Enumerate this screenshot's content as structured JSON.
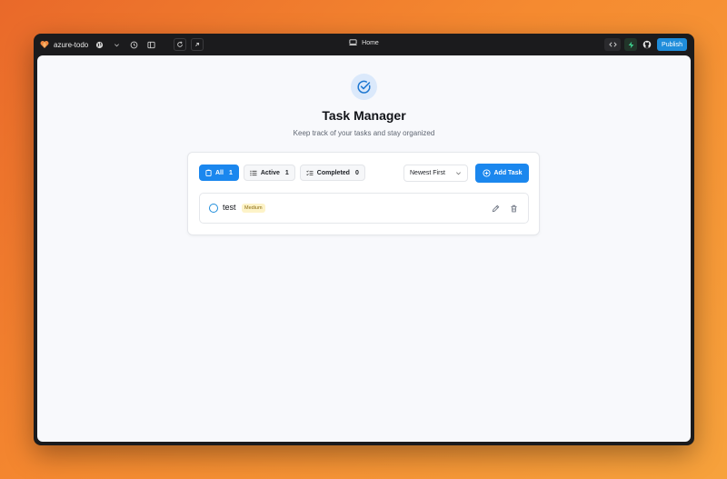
{
  "topbar": {
    "app_name": "azure-todo",
    "center_title": "Home",
    "publish_label": "Publish"
  },
  "header": {
    "title": "Task Manager",
    "subtitle": "Keep track of your tasks and stay organized"
  },
  "filters": [
    {
      "label": "All",
      "count": "1",
      "active": true
    },
    {
      "label": "Active",
      "count": "1",
      "active": false
    },
    {
      "label": "Completed",
      "count": "0",
      "active": false
    }
  ],
  "sort": {
    "selected": "Newest First"
  },
  "add_task_label": "Add Task",
  "tasks": [
    {
      "title": "test",
      "priority": "Medium",
      "completed": false
    }
  ],
  "colors": {
    "accent": "#1b87ee",
    "priority_medium_bg": "#fdf3c8",
    "priority_medium_text": "#8a6b12"
  }
}
